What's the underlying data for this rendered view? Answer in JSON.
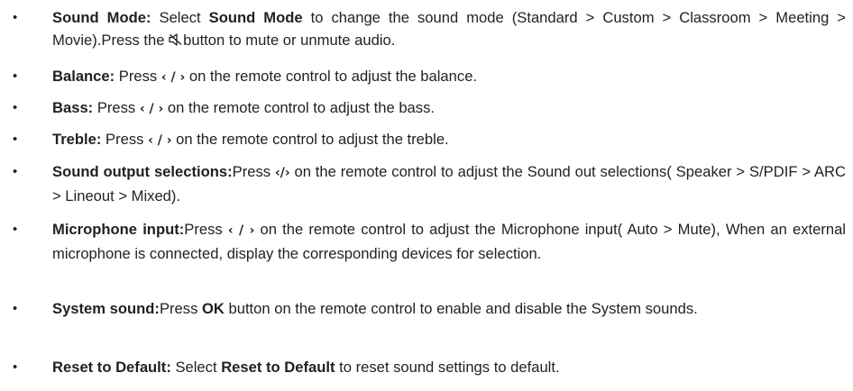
{
  "items": [
    {
      "label": "Sound Mode:",
      "t1": " Select ",
      "b1": "Sound Mode",
      "t2": " to change the sound mode (Standard > Custom > Classroom > Meeting > Movie).Press the ",
      "t3": "button to mute or unmute audio."
    },
    {
      "label": "Balance:",
      "t1": " Press",
      "glyph": "‹ / ›",
      "t2": "on the remote control to adjust the balance."
    },
    {
      "label": "Bass:",
      "t1": " Press",
      "glyph": "‹ / ›",
      "t2": "on the remote control to adjust the bass."
    },
    {
      "label": "Treble:",
      "t1": " Press",
      "glyph": "‹ / ›",
      "t2": "on the remote control to adjust the treble."
    },
    {
      "label": "Sound output selections:",
      "t1": "Press ",
      "glyph": "‹/›",
      "t2": " on the remote control to adjust the Sound out selections( Speaker > S/PDIF > ARC > Lineout > Mixed)."
    },
    {
      "label": "Microphone input:",
      "t1": "Press ",
      "glyph": "‹ / ›",
      "t2": " on the remote control to adjust the Microphone input( Auto > Mute), When an external microphone is connected, display the corresponding devices for selection."
    },
    {
      "label": "System sound:",
      "t1": "Press ",
      "b1": "OK",
      "t2": " button on the remote control to enable and disable the System sounds."
    },
    {
      "label": "Reset to Default:",
      "t1": " Select ",
      "b1": "Reset to Default",
      "t2": " to reset sound settings to default."
    }
  ],
  "bullet_char": "•"
}
